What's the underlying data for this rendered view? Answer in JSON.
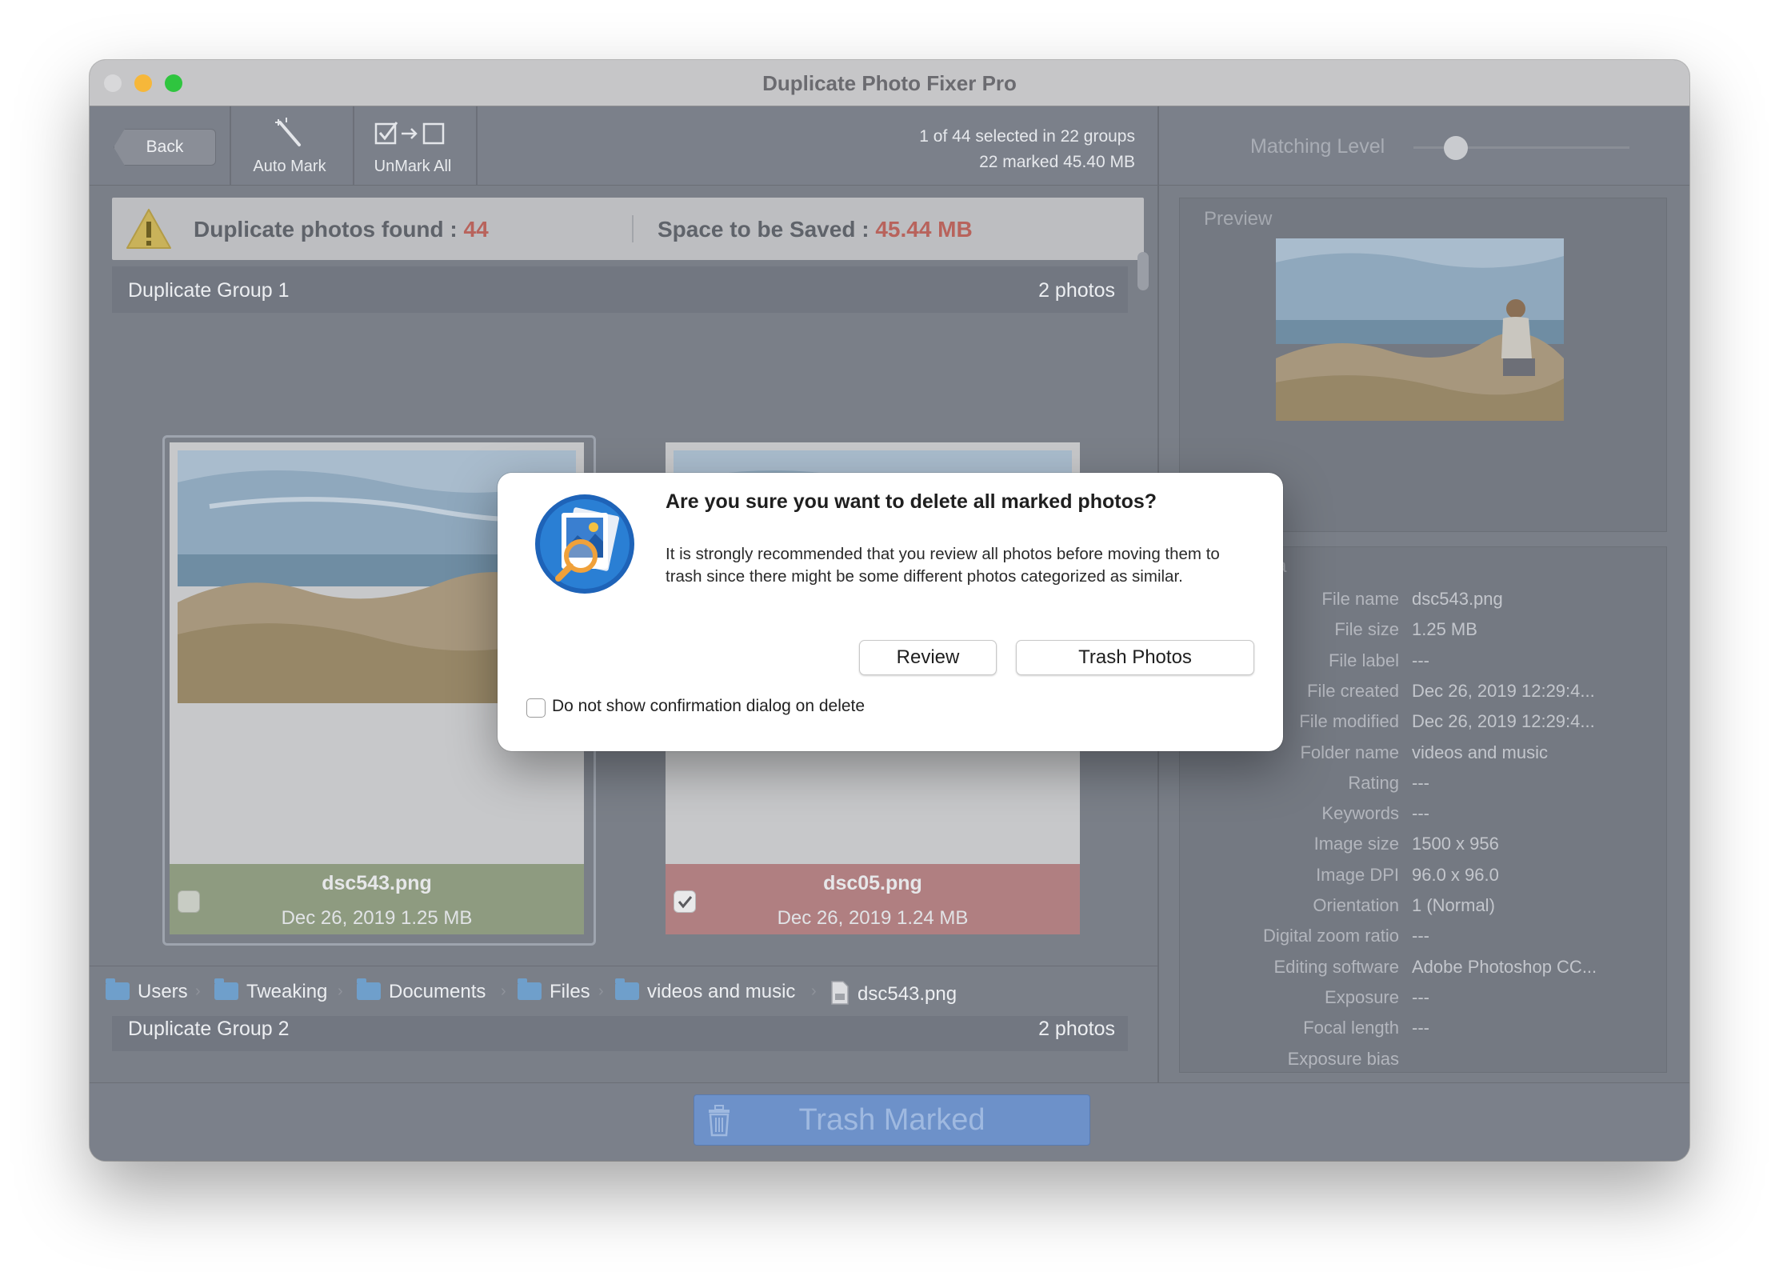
{
  "window": {
    "title": "Duplicate Photo Fixer Pro",
    "traffic_colors": [
      "#d8d8da",
      "#f6b73a",
      "#2fc53f"
    ]
  },
  "toolbar": {
    "back_label": "Back",
    "auto_mark_label": "Auto Mark",
    "unmark_all_label": "UnMark All",
    "selection_line1": "1 of 44 selected in 22 groups",
    "selection_line2": "22 marked 45.40 MB"
  },
  "matching": {
    "label": "Matching Level"
  },
  "banner": {
    "found_label": "Duplicate photos found :",
    "found_value": "44",
    "saved_label": "Space to be Saved :",
    "saved_value": "45.44 MB",
    "accent_color": "#b8635c"
  },
  "groups": [
    {
      "name": "Duplicate Group 1",
      "count": "2 photos",
      "photos": [
        {
          "file": "dsc543.png",
          "meta": "Dec 26, 2019 1.25 MB",
          "checked": false,
          "status_color": "#8e9b80"
        },
        {
          "file": "dsc05.png",
          "meta": "Dec 26, 2019 1.24 MB",
          "checked": true,
          "status_color": "#b07f81"
        }
      ]
    },
    {
      "name": "Duplicate Group 2",
      "count": "2 photos"
    }
  ],
  "path": [
    {
      "label": "Users",
      "icon": "folder-icon"
    },
    {
      "label": "Tweaking",
      "icon": "folder-icon"
    },
    {
      "label": "Documents",
      "icon": "folder-icon"
    },
    {
      "label": "Files",
      "icon": "folder-icon"
    },
    {
      "label": "videos and music",
      "icon": "folder-icon"
    },
    {
      "label": "dsc543.png",
      "icon": "file-icon"
    }
  ],
  "bottom": {
    "trash_marked_label": "Trash Marked"
  },
  "preview": {
    "label": "Preview",
    "partial_meta_label": "a"
  },
  "metadata": [
    {
      "key": "File name",
      "value": "dsc543.png"
    },
    {
      "key": "File size",
      "value": "1.25 MB"
    },
    {
      "key": "File label",
      "value": "---"
    },
    {
      "key": "File created",
      "value": "Dec 26, 2019 12:29:4..."
    },
    {
      "key": "File modified",
      "value": "Dec 26, 2019 12:29:4..."
    },
    {
      "key": "Folder name",
      "value": "videos and music"
    },
    {
      "key": "Rating",
      "value": "---"
    },
    {
      "key": "Keywords",
      "value": "---"
    },
    {
      "key": "Image size",
      "value": "1500 x 956"
    },
    {
      "key": "Image DPI",
      "value": "96.0 x 96.0"
    },
    {
      "key": "Orientation",
      "value": "1 (Normal)"
    },
    {
      "key": "Digital zoom ratio",
      "value": "---"
    },
    {
      "key": "Editing software",
      "value": "Adobe Photoshop CC..."
    },
    {
      "key": "Exposure",
      "value": "---"
    },
    {
      "key": "Focal length",
      "value": "---"
    },
    {
      "key": "Exposure bias",
      "value": ""
    }
  ],
  "dialog": {
    "title": "Are you sure you want to delete all marked photos?",
    "message": "It is strongly recommended that you review all photos before moving them to trash since there might be some different photos categorized as similar.",
    "review_label": "Review",
    "trash_label": "Trash Photos",
    "checkbox_label": "Do not show confirmation dialog on delete",
    "checkbox_checked": false
  }
}
